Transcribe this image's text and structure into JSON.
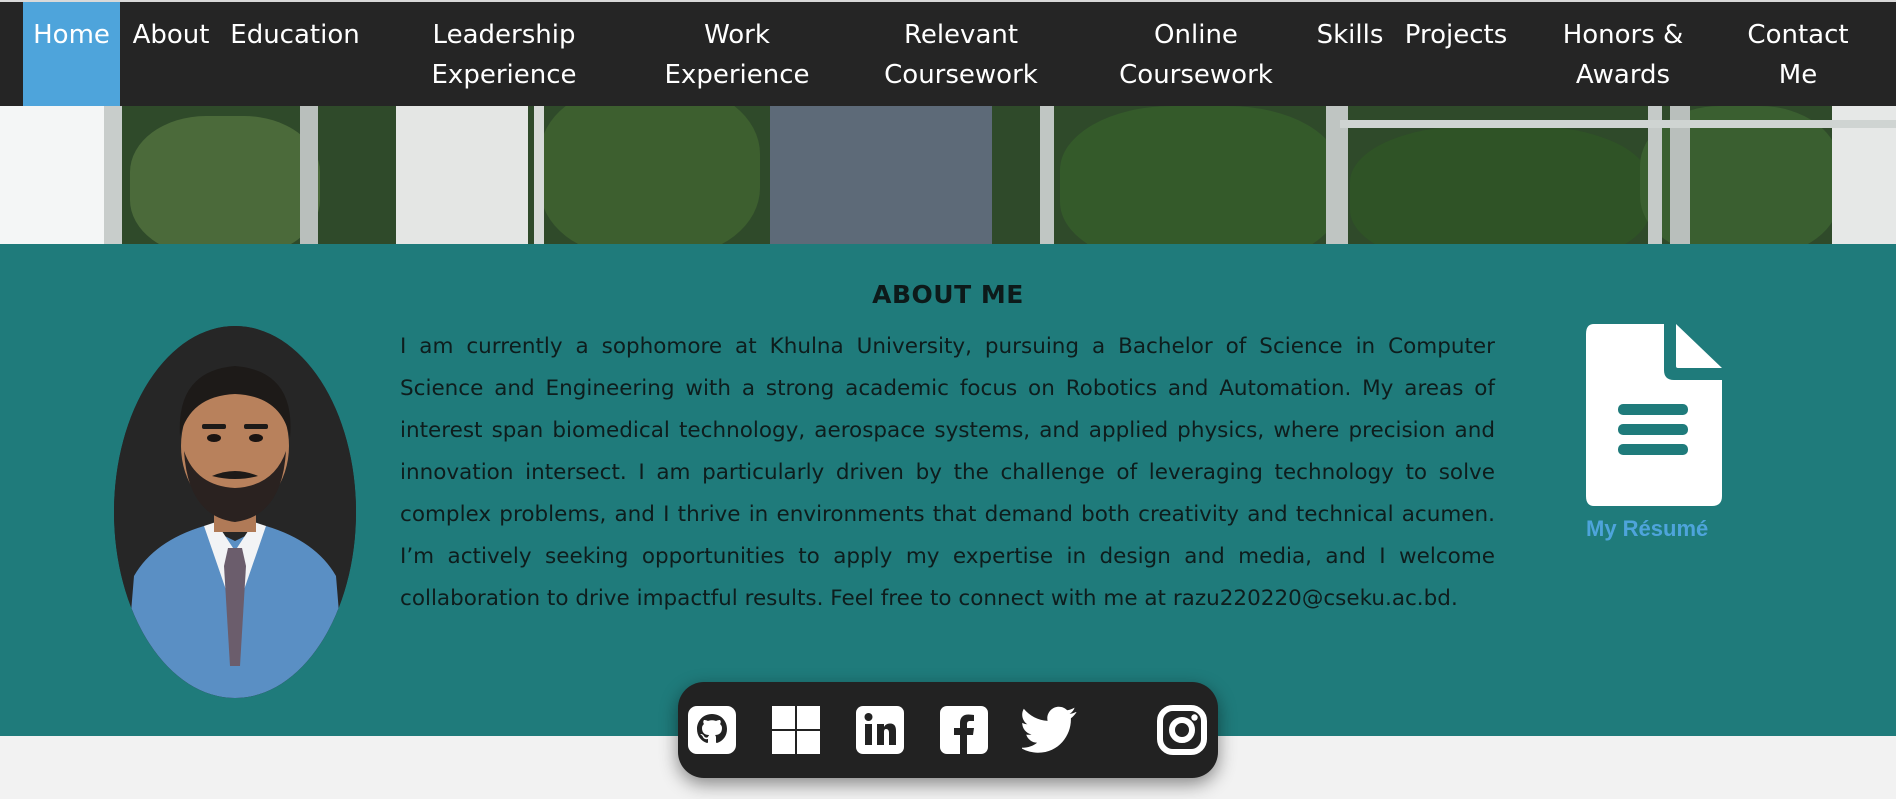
{
  "nav": {
    "items": [
      {
        "label": "Home",
        "active": true
      },
      {
        "label": "About"
      },
      {
        "label": "Education"
      },
      {
        "label": "Leadership\nExperience"
      },
      {
        "label": "Work\nExperience"
      },
      {
        "label": "Relevant\nCoursework"
      },
      {
        "label": "Online\nCoursework"
      },
      {
        "label": "Skills"
      },
      {
        "label": "Projects"
      },
      {
        "label": "Honors &\nAwards"
      },
      {
        "label": "Contact\nMe"
      }
    ]
  },
  "about": {
    "title": "ABOUT ME",
    "text": "I am currently a sophomore at Khulna University, pursuing a Bachelor of Science in Computer Science and Engineering with a strong academic focus on Robotics and Automation. My areas of interest span biomedical technology, aerospace systems, and applied physics, where precision and innovation intersect. I am particularly driven by the challenge of leveraging technology to solve complex problems, and I thrive in environments that demand both creativity and technical acumen. I’m actively seeking opportunities to apply my expertise in design and media, and I welcome collaboration to drive impactful results. Feel free to connect with me at razu220220@cseku.ac.bd."
  },
  "resume": {
    "label": "My Résumé",
    "icon": "document-icon"
  },
  "social": {
    "icons": [
      "github-icon",
      "windows-icon",
      "linkedin-icon",
      "facebook-icon",
      "twitter-icon",
      "instagram-icon"
    ]
  },
  "colors": {
    "nav_bg": "#252525",
    "nav_active": "#4ea4db",
    "section_bg": "#1f7b7b",
    "accent": "#4ea4db"
  }
}
